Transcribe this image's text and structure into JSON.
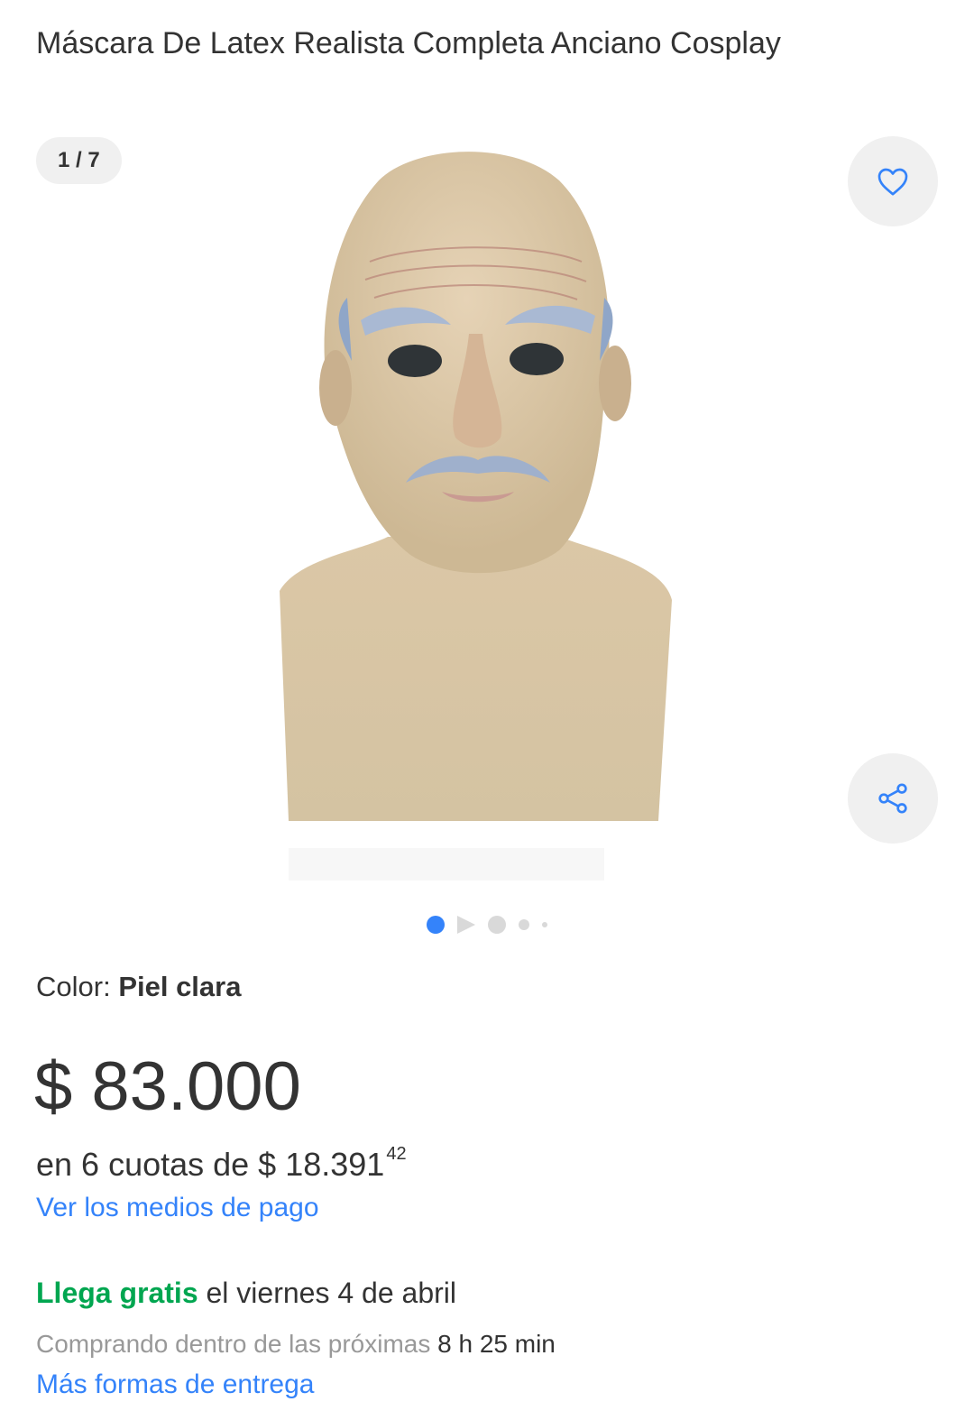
{
  "colors": {
    "accent": "#3483fa",
    "green": "#00a650",
    "text": "#333333",
    "muted": "#999999",
    "chip_bg": "#f0f0f0"
  },
  "product": {
    "title": "Máscara De Latex Realista Completa Anciano Cosplay"
  },
  "gallery": {
    "counter": "1 / 7",
    "favorite_icon": "heart-icon",
    "share_icon": "share-icon",
    "dots": [
      "active",
      "video",
      "image",
      "image",
      "image"
    ]
  },
  "variant": {
    "label": "Color: ",
    "value": "Piel clara"
  },
  "pricing": {
    "price": "$ 83.000",
    "installments_prefix": "en 6 cuotas de $ 18.391",
    "installments_cents": "42",
    "payment_link": "Ver los medios de pago"
  },
  "shipping": {
    "highlight": "Llega gratis",
    "rest": " el viernes 4 de abril",
    "window_prefix": "Comprando dentro de las próximas ",
    "window_time": "8 h 25 min",
    "more_link": "Más formas de entrega"
  }
}
